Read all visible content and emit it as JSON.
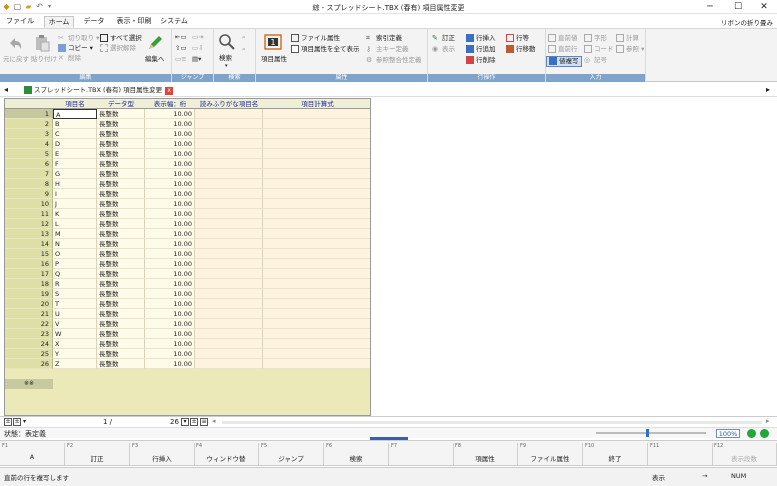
{
  "window": {
    "title": "綜 - スプレッドシート.TBX (春有) 項目属性変更",
    "minimize_glyph": "─",
    "maximize_glyph": "☐",
    "close_glyph": "✕"
  },
  "menu": {
    "tabs": [
      "ファイル",
      "ホーム",
      "データ",
      "表示・印刷",
      "システム"
    ],
    "active": "ホーム",
    "ribbon_minimize": "リボンの折り畳み"
  },
  "ribbon": {
    "groups": {
      "edit": {
        "title": "編集",
        "undo": "元に戻す",
        "paste": "貼り付け",
        "cut": "切り取り",
        "copy": "コピー",
        "delete": "削除",
        "select_all": "すべて選択",
        "deselect": "選択解除",
        "edit_mode": "編集へ"
      },
      "jump": {
        "title": "ジャンプ"
      },
      "search": {
        "title": "検索",
        "search": "検索"
      },
      "attr": {
        "title": "属性",
        "item_attr": "項目属性",
        "file_attr": "ファイル属性",
        "show_all_attr": "項目属性を全て表示",
        "index_def": "索引定義",
        "primary_key": "主キー定義",
        "ref_integrity": "参照整合性定義"
      },
      "row": {
        "title": "行操作",
        "correct": "訂正",
        "display": "表示",
        "insert_row": "行挿入",
        "add_row": "行追加",
        "delete_row": "行削除",
        "row_etc": "行等",
        "move_row": "行移動"
      },
      "input": {
        "title": "入力",
        "prev_value": "直前値",
        "prev_row": "直前行",
        "copy_value": "値複写",
        "char_shape": "字形",
        "code": "コード",
        "symbol": "記号",
        "calc": "計算",
        "ref": "参照"
      }
    }
  },
  "document_tab": {
    "label": "スプレッドシート.TBX (春有) 項目属性変更",
    "close": "x"
  },
  "sheet": {
    "columns": [
      "項目名",
      "データ型",
      "表示幅：桁",
      "読みふりがな項目名",
      "項目計算式"
    ],
    "rows": [
      {
        "n": "1",
        "name": "A",
        "type": "長整数",
        "width": "10.00"
      },
      {
        "n": "2",
        "name": "B",
        "type": "長整数",
        "width": "10.00"
      },
      {
        "n": "3",
        "name": "C",
        "type": "長整数",
        "width": "10.00"
      },
      {
        "n": "4",
        "name": "D",
        "type": "長整数",
        "width": "10.00"
      },
      {
        "n": "5",
        "name": "E",
        "type": "長整数",
        "width": "10.00"
      },
      {
        "n": "6",
        "name": "F",
        "type": "長整数",
        "width": "10.00"
      },
      {
        "n": "7",
        "name": "G",
        "type": "長整数",
        "width": "10.00"
      },
      {
        "n": "8",
        "name": "H",
        "type": "長整数",
        "width": "10.00"
      },
      {
        "n": "9",
        "name": "I",
        "type": "長整数",
        "width": "10.00"
      },
      {
        "n": "10",
        "name": "J",
        "type": "長整数",
        "width": "10.00"
      },
      {
        "n": "11",
        "name": "K",
        "type": "長整数",
        "width": "10.00"
      },
      {
        "n": "12",
        "name": "L",
        "type": "長整数",
        "width": "10.00"
      },
      {
        "n": "13",
        "name": "M",
        "type": "長整数",
        "width": "10.00"
      },
      {
        "n": "14",
        "name": "N",
        "type": "長整数",
        "width": "10.00"
      },
      {
        "n": "15",
        "name": "O",
        "type": "長整数",
        "width": "10.00"
      },
      {
        "n": "16",
        "name": "P",
        "type": "長整数",
        "width": "10.00"
      },
      {
        "n": "17",
        "name": "Q",
        "type": "長整数",
        "width": "10.00"
      },
      {
        "n": "18",
        "name": "R",
        "type": "長整数",
        "width": "10.00"
      },
      {
        "n": "19",
        "name": "S",
        "type": "長整数",
        "width": "10.00"
      },
      {
        "n": "20",
        "name": "T",
        "type": "長整数",
        "width": "10.00"
      },
      {
        "n": "21",
        "name": "U",
        "type": "長整数",
        "width": "10.00"
      },
      {
        "n": "22",
        "name": "V",
        "type": "長整数",
        "width": "10.00"
      },
      {
        "n": "23",
        "name": "W",
        "type": "長整数",
        "width": "10.00"
      },
      {
        "n": "24",
        "name": "X",
        "type": "長整数",
        "width": "10.00"
      },
      {
        "n": "25",
        "name": "Y",
        "type": "長整数",
        "width": "10.00"
      },
      {
        "n": "26",
        "name": "Z",
        "type": "長整数",
        "width": "10.00"
      }
    ],
    "new_row_marker": "※※"
  },
  "footer": {
    "page_current": "1 /",
    "page_total": "26",
    "status": "状態：表定義",
    "zoom": "100%"
  },
  "fkeys": [
    {
      "n": "F1",
      "label": "A",
      "dim": false
    },
    {
      "n": "F2",
      "label": "訂正",
      "dim": false
    },
    {
      "n": "F3",
      "label": "行挿入",
      "dim": false
    },
    {
      "n": "F4",
      "label": "ウィンドウ替",
      "dim": false
    },
    {
      "n": "F5",
      "label": "ジャンプ",
      "dim": false
    },
    {
      "n": "F6",
      "label": "検索",
      "dim": false
    },
    {
      "n": "F7",
      "label": "",
      "dim": false
    },
    {
      "n": "F8",
      "label": "項属性",
      "dim": false
    },
    {
      "n": "F9",
      "label": "ファイル属性",
      "dim": false
    },
    {
      "n": "F10",
      "label": "終了",
      "dim": false
    },
    {
      "n": "F11",
      "label": "",
      "dim": false
    },
    {
      "n": "F12",
      "label": "表示段数",
      "dim": true
    }
  ],
  "statusbar": {
    "message": "直前の行を複写します",
    "mode": "表示",
    "arrow": "→",
    "numlock": "NUM"
  }
}
